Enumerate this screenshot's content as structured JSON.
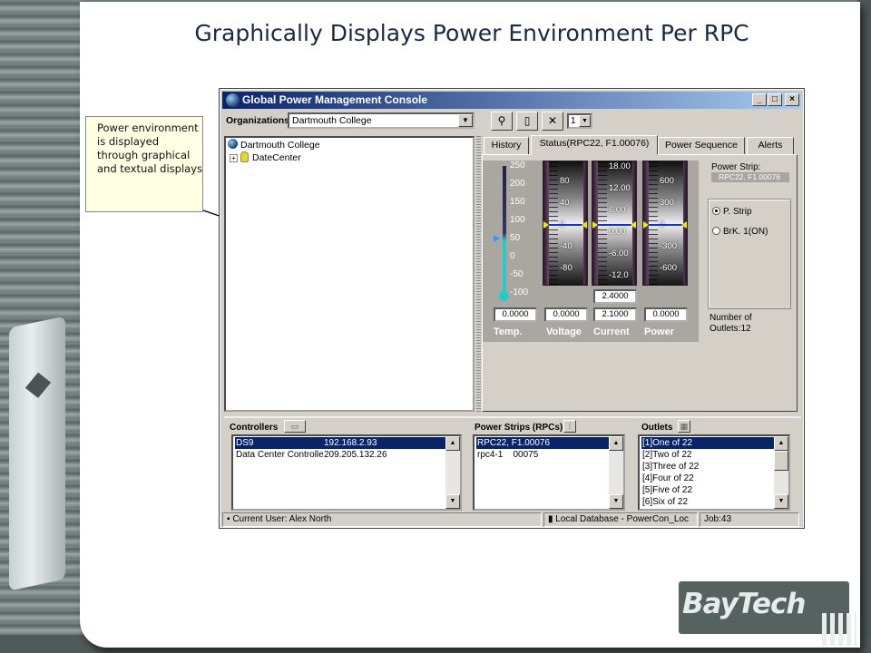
{
  "slide": {
    "title": "Graphically Displays Power Environment Per RPC",
    "callout_text": "Power environment is displayed through graphical and textual displays",
    "logo_text": "BayTech"
  },
  "window": {
    "title": "Global Power Management Console",
    "controls": [
      "_",
      "□",
      "×"
    ]
  },
  "toolbar": {
    "org_label": "Organizations:",
    "org_value": "Dartmouth College",
    "number_value": "1"
  },
  "tree": {
    "root": "Dartmouth College",
    "child": "DateCenter"
  },
  "tabs": [
    "History",
    "Status(RPC22, F1.00076)",
    "Power Sequence",
    "Alerts"
  ],
  "meters": {
    "temp_ticks": [
      "250",
      "200",
      "150",
      "100",
      "50",
      "0",
      "-50",
      "-100"
    ],
    "voltage_ticks": [
      "80",
      "40",
      "0",
      "-40",
      "-80"
    ],
    "current_ticks": [
      "18.00",
      "12.00",
      "6.00",
      "0.00",
      "-6.00",
      "-12.0"
    ],
    "power_ticks": [
      "600",
      "300",
      "0",
      "-300",
      "-600"
    ],
    "current_extra": "2.4000",
    "readouts": [
      "0.0000",
      "0.0000",
      "2.1000",
      "0.0000"
    ],
    "captions": [
      "Temp.",
      "Voltage",
      "Current",
      "Power"
    ]
  },
  "strip": {
    "label": "Power Strip:",
    "value": "RPC22, F1.00076",
    "radio_pstrip": "P. Strip",
    "radio_brk": "BrK. 1(ON)",
    "outlets_note_1": "Number of",
    "outlets_note_2": "Outlets:12"
  },
  "lower": {
    "controllers_label": "Controllers",
    "controllers": [
      {
        "name": "DS9",
        "ip": "192.168.2.93"
      },
      {
        "name": "Data Center Controlle",
        "ip": "209.205.132.26"
      }
    ],
    "strips_label": "Power Strips (RPCs)",
    "strips": [
      "RPC22, F1.00076",
      "rpc4-1    00075"
    ],
    "outlets_label": "Outlets",
    "outlets": [
      "[1]One of 22",
      "[2]Two of 22",
      "[3]Three of 22",
      "[4]Four of 22",
      "[5]Five of 22",
      "[6]Six of 22"
    ]
  },
  "status": {
    "user": "Current User: Alex North",
    "db": "Local Database - PowerCon_Loc",
    "job": "Job:43"
  },
  "colors": {
    "titlebar": "#0a246a",
    "selection": "#0a246a",
    "gauge_marker": "#eeee00"
  }
}
